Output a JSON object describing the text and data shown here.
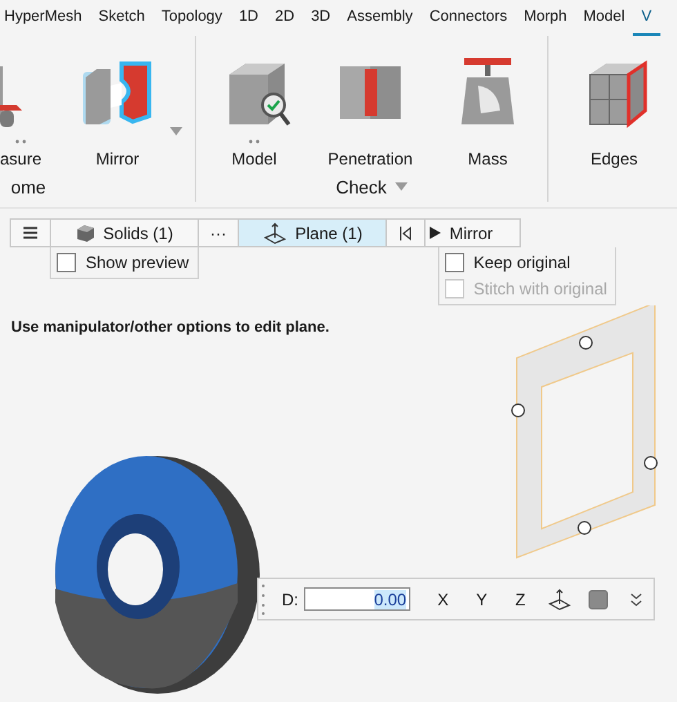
{
  "menu": [
    {
      "label": "HyperMesh",
      "selected": false
    },
    {
      "label": "Sketch",
      "selected": false
    },
    {
      "label": "Topology",
      "selected": false
    },
    {
      "label": "1D",
      "selected": false
    },
    {
      "label": "2D",
      "selected": false
    },
    {
      "label": "3D",
      "selected": false
    },
    {
      "label": "Assembly",
      "selected": false
    },
    {
      "label": "Connectors",
      "selected": false
    },
    {
      "label": "Morph",
      "selected": false
    },
    {
      "label": "Model",
      "selected": false
    },
    {
      "label": "V",
      "selected": true
    }
  ],
  "ribbon": {
    "groups": [
      {
        "label": "ome",
        "items": [
          {
            "label": "asure",
            "more_options": true
          },
          {
            "label": "Mirror",
            "caret": true
          }
        ]
      },
      {
        "label": "Check",
        "dropdown": true,
        "items": [
          {
            "label": "Model",
            "more_options": true
          },
          {
            "label": "Penetration"
          },
          {
            "label": "Mass"
          }
        ]
      },
      {
        "items": [
          {
            "label": "Edges"
          }
        ]
      }
    ]
  },
  "toolbar": [
    {
      "kind": "menu",
      "selected": false
    },
    {
      "kind": "solids",
      "label": "Solids (1)",
      "selected": false
    },
    {
      "kind": "more",
      "label": "···",
      "selected": false
    },
    {
      "kind": "plane",
      "label": "Plane (1)",
      "selected": true
    },
    {
      "kind": "reset",
      "selected": false
    },
    {
      "kind": "run",
      "label": "Mirror",
      "selected": false
    }
  ],
  "selection_options": [
    {
      "label": "Show preview",
      "checked": false,
      "disabled": false
    }
  ],
  "mirror_options": [
    {
      "label": "Keep original",
      "checked": false,
      "disabled": false
    },
    {
      "label": "Stitch with original",
      "checked": false,
      "disabled": true
    }
  ],
  "instruction": "Use manipulator/other options to edit plane.",
  "plane_bar": {
    "label": "D:",
    "value": "0.00",
    "axes": [
      "X",
      "Y",
      "Z"
    ]
  }
}
